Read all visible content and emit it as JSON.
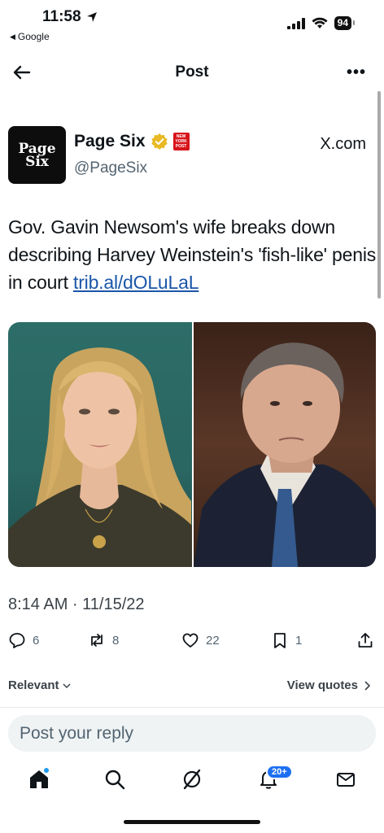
{
  "status_bar": {
    "time": "11:58",
    "back_app": "Google",
    "battery": "94"
  },
  "header": {
    "title": "Post"
  },
  "author": {
    "avatar_line1": "Page",
    "avatar_line2": "Six",
    "name": "Page Six",
    "handle": "@PageSix",
    "source": "X.com"
  },
  "post": {
    "text": "Gov. Gavin Newsom's wife breaks down describing Harvey Weinstein's 'fish-like' penis in court ",
    "link": "trib.al/dOLuLaL",
    "timestamp": "8:14 AM · 11/15/22"
  },
  "actions": {
    "replies": "6",
    "reposts": "8",
    "likes": "22",
    "bookmarks": "1"
  },
  "sort": {
    "relevant_label": "Relevant",
    "view_quotes_label": "View quotes"
  },
  "reply": {
    "placeholder": "Post your reply"
  },
  "bottom_nav": {
    "notifications_badge": "20+"
  },
  "colors": {
    "link": "#1b56a8",
    "accent": "#1d9bf0",
    "badge": "#1d6ff2",
    "verified_gold": "#e8b923"
  }
}
